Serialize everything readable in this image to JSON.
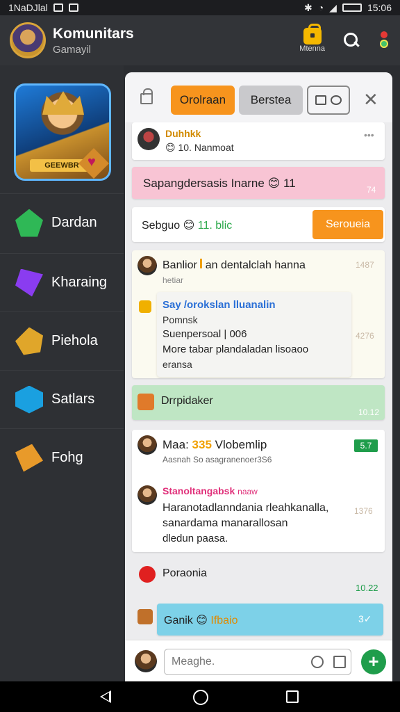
{
  "status_bar": {
    "carrier": "1NaDJlal",
    "time": "15:06"
  },
  "header": {
    "title": "Komunitars",
    "subtitle": "Gamayil",
    "badge_label": "Mtenna"
  },
  "sidebar": {
    "hero_name": "GEEWBR",
    "items": [
      {
        "label": "Dardan",
        "icon": "green-gem-icon"
      },
      {
        "label": "Kharaing",
        "icon": "purple-gem-icon"
      },
      {
        "label": "Piehola",
        "icon": "gold-cube-icon"
      },
      {
        "label": "Satlars",
        "icon": "cyan-gem-icon"
      },
      {
        "label": "Fohg",
        "icon": "heart-gem-icon"
      }
    ]
  },
  "tabs": {
    "active": "Orolraan",
    "second": "Berstea"
  },
  "messages": {
    "m1": {
      "name": "Duhhkk",
      "text": "10. Nanmoat"
    },
    "m2": {
      "text": "Sapangdersasis Inarne",
      "count": "11",
      "time": "74"
    },
    "m3": {
      "label": "Sebguo",
      "stat": "11. blic",
      "button": "Seroueia"
    },
    "m4": {
      "name": "Banlior",
      "title_rest": "an dentalclah hanna",
      "sub": "hetiar",
      "time": "1487",
      "nested": {
        "title": "Say /orokslan lluanalin",
        "line1": "Pomnsk",
        "line2": "Suenpersoal | 006",
        "line3": "More tabar plandaladan lisoaoo",
        "line4": "eransa",
        "time": "4276"
      }
    },
    "m5": {
      "text": "Drrpidaker",
      "time": "10.12"
    },
    "m6": {
      "name": "Maa:",
      "highlight": "335",
      "name_rest": "Vlobemlip",
      "badge": "5.7",
      "sub": "Aasnah So asagranenoer3S6"
    },
    "m7": {
      "name": "Stanoltangabsk",
      "tag": "naaw",
      "line1": "Haranotadlanndania rleahkanalla,",
      "line2": "sanardama manarallosan",
      "line3": "dledun paasa.",
      "time": "1376"
    },
    "m8": {
      "text": "Poraonia",
      "time": "10.22"
    },
    "m9": {
      "text": "Ganik",
      "tag": "Ifbaio",
      "count": "3"
    }
  },
  "composer": {
    "placeholder": "Meaghe."
  },
  "colors": {
    "accent_orange": "#f7941d",
    "green": "#1f9d4b",
    "pink": "#f8c4d4",
    "mint": "#bfe6c4",
    "cyan": "#7dd1e8"
  }
}
